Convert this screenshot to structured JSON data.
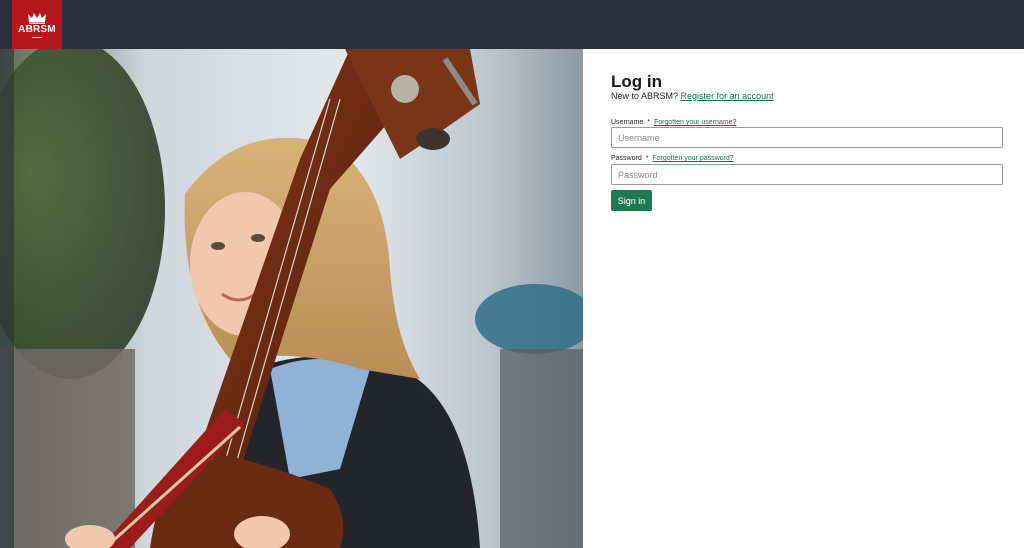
{
  "brand": {
    "logo_text": "ABRSM",
    "logo_color": "#b5161c",
    "logo_icon": "crown-icon"
  },
  "colors": {
    "topbar": "#2c2e3b",
    "accent": "#1d7a55",
    "link": "#1b6b4e"
  },
  "hero": {
    "image": "girl-with-double-bass-photo"
  },
  "login": {
    "title": "Log in",
    "new_prompt": "New to ABRSM?",
    "register_link": "Register for an account",
    "username": {
      "label": "Username",
      "required_marker": "*",
      "help_link": "Forgotten your username?",
      "placeholder": "Username",
      "value": ""
    },
    "password": {
      "label": "Password",
      "required_marker": "*",
      "help_link": "Forgotten your password?",
      "placeholder": "Password",
      "value": ""
    },
    "submit_label": "Sign in"
  }
}
